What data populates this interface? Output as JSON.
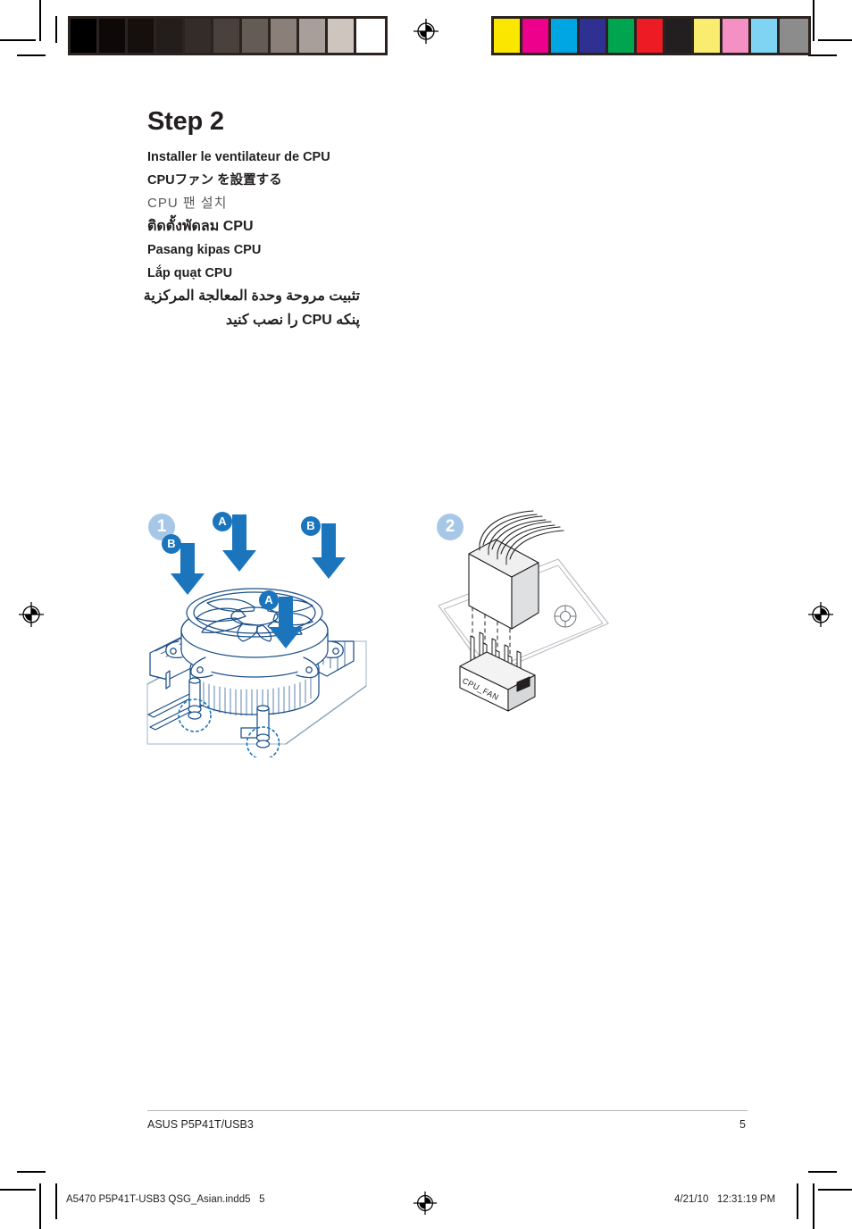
{
  "document": {
    "step_title": "Step 2",
    "languages": [
      {
        "id": "french",
        "text": "Installer le ventilateur de CPU"
      },
      {
        "id": "japanese",
        "text": "CPUファン を設置する"
      },
      {
        "id": "korean",
        "text": "CPU 팬 설치"
      },
      {
        "id": "thai",
        "text": "ติดตั้งพัดลม CPU"
      },
      {
        "id": "indonesian",
        "text": "Pasang kipas CPU"
      },
      {
        "id": "vietnamese",
        "text": "Lắp quạt CPU"
      },
      {
        "id": "arabic",
        "text": "تثبيت مروحة وحدة المعالجة المركزية"
      },
      {
        "id": "persian",
        "text": "پنکه CPU را نصب کنید"
      }
    ]
  },
  "figures": {
    "panel1": {
      "step_number": "1",
      "callouts": [
        {
          "id": "a-top",
          "label": "A"
        },
        {
          "id": "b-left",
          "label": "B"
        },
        {
          "id": "b-right",
          "label": "B"
        },
        {
          "id": "a-mid",
          "label": "A"
        }
      ]
    },
    "panel2": {
      "step_number": "2",
      "connector_label": "CPU_FAN"
    }
  },
  "footer": {
    "product": "ASUS P5P41T/USB3",
    "page_number": "5"
  },
  "print_slug": {
    "filename": "A5470 P5P41T-USB3 QSG_Asian.indd5   5",
    "timestamp": "4/21/10   12:31:19 PM"
  },
  "colors": {
    "grayscale_bar": [
      "#000000",
      "#0c0908",
      "#15100e",
      "#231d1b",
      "#342c28",
      "#4a413c",
      "#655b55",
      "#8a7f79",
      "#a89f9a",
      "#cec5bf",
      "#ffffff"
    ],
    "color_bar": [
      "#fbe600",
      "#ec008c",
      "#00a6e2",
      "#2e3192",
      "#00a550",
      "#ed1c24",
      "#231f20",
      "#faec6e",
      "#f490c3",
      "#7fd4f4",
      "#8c8c8c"
    ],
    "step_badge": "#a7c7e7",
    "callout_badge": "#1b75bc",
    "arrow": "#1b75bc",
    "line_art": "#1b4f8a",
    "text": "#231f20"
  }
}
